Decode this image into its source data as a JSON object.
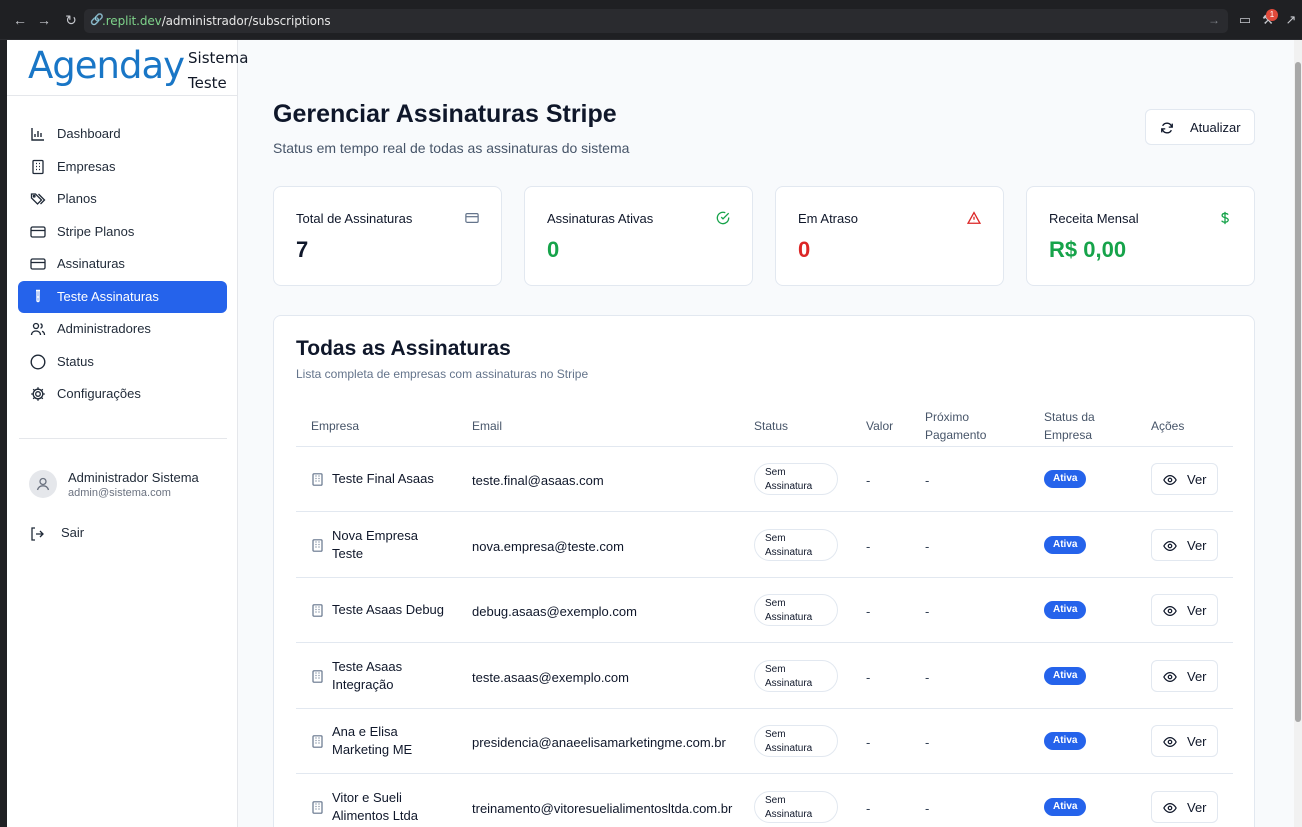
{
  "browser": {
    "url_host": ".replit.dev",
    "url_path": "/administrador/subscriptions",
    "badge": "1"
  },
  "sidebar": {
    "logo": "Agenday",
    "logo_sub_1": "Sistema",
    "logo_sub_2": "Teste",
    "items": [
      {
        "label": "Dashboard",
        "icon": "bar-chart-icon"
      },
      {
        "label": "Empresas",
        "icon": "building-icon"
      },
      {
        "label": "Planos",
        "icon": "tags-icon"
      },
      {
        "label": "Stripe Planos",
        "icon": "credit-card-icon"
      },
      {
        "label": "Assinaturas",
        "icon": "credit-card-icon"
      },
      {
        "label": "Teste Assinaturas",
        "icon": "test-tube-icon"
      },
      {
        "label": "Administradores",
        "icon": "users-icon"
      },
      {
        "label": "Status",
        "icon": "circle-icon"
      },
      {
        "label": "Configurações",
        "icon": "gear-icon"
      }
    ],
    "active_index": 5,
    "user": {
      "name": "Administrador Sistema",
      "email": "admin@sistema.com"
    },
    "logout_label": "Sair"
  },
  "header": {
    "title": "Gerenciar Assinaturas Stripe",
    "subtitle": "Status em tempo real de todas as assinaturas do sistema",
    "refresh_label": "Atualizar"
  },
  "stats": [
    {
      "label": "Total de Assinaturas",
      "value": "7",
      "color": "#0f172a",
      "icon": "credit-card-icon"
    },
    {
      "label": "Assinaturas Ativas",
      "value": "0",
      "color": "#16a34a",
      "icon": "check-circle-icon"
    },
    {
      "label": "Em Atraso",
      "value": "0",
      "color": "#dc2626",
      "icon": "alert-triangle-icon"
    },
    {
      "label": "Receita Mensal",
      "value": "R$ 0,00",
      "color": "#16a34a",
      "icon": "dollar-icon"
    }
  ],
  "table": {
    "title": "Todas as Assinaturas",
    "subtitle": "Lista completa de empresas com assinaturas no Stripe",
    "headers": {
      "empresa": "Empresa",
      "email": "Email",
      "status": "Status",
      "valor": "Valor",
      "proximo_1": "Próximo",
      "proximo_2": "Pagamento",
      "status_empresa_1": "Status da",
      "status_empresa_2": "Empresa",
      "acoes": "Ações"
    },
    "rows": [
      {
        "name_1": "Teste Final Asaas",
        "name_2": "",
        "email": "teste.final@asaas.com",
        "status_1": "Sem",
        "status_2": "Assinatura",
        "valor": "-",
        "proximo": "-",
        "empresa_status": "Ativa",
        "action": "Ver"
      },
      {
        "name_1": "Nova Empresa",
        "name_2": "Teste",
        "email": "nova.empresa@teste.com",
        "status_1": "Sem",
        "status_2": "Assinatura",
        "valor": "-",
        "proximo": "-",
        "empresa_status": "Ativa",
        "action": "Ver"
      },
      {
        "name_1": "Teste Asaas Debug",
        "name_2": "",
        "email": "debug.asaas@exemplo.com",
        "status_1": "Sem",
        "status_2": "Assinatura",
        "valor": "-",
        "proximo": "-",
        "empresa_status": "Ativa",
        "action": "Ver"
      },
      {
        "name_1": "Teste Asaas",
        "name_2": "Integração",
        "email": "teste.asaas@exemplo.com",
        "status_1": "Sem",
        "status_2": "Assinatura",
        "valor": "-",
        "proximo": "-",
        "empresa_status": "Ativa",
        "action": "Ver"
      },
      {
        "name_1": "Ana e Elisa",
        "name_2": "Marketing ME",
        "email": "presidencia@anaeelisamarketingme.com.br",
        "status_1": "Sem",
        "status_2": "Assinatura",
        "valor": "-",
        "proximo": "-",
        "empresa_status": "Ativa",
        "action": "Ver"
      },
      {
        "name_1": "Vitor e Sueli",
        "name_2": "Alimentos Ltda",
        "email": "treinamento@vitoresuelialimentosltda.com.br",
        "status_1": "Sem",
        "status_2": "Assinatura",
        "valor": "-",
        "proximo": "-",
        "empresa_status": "Ativa",
        "action": "Ver"
      }
    ]
  },
  "colors": {
    "accent": "#2563eb",
    "logo": "#1976c6"
  }
}
